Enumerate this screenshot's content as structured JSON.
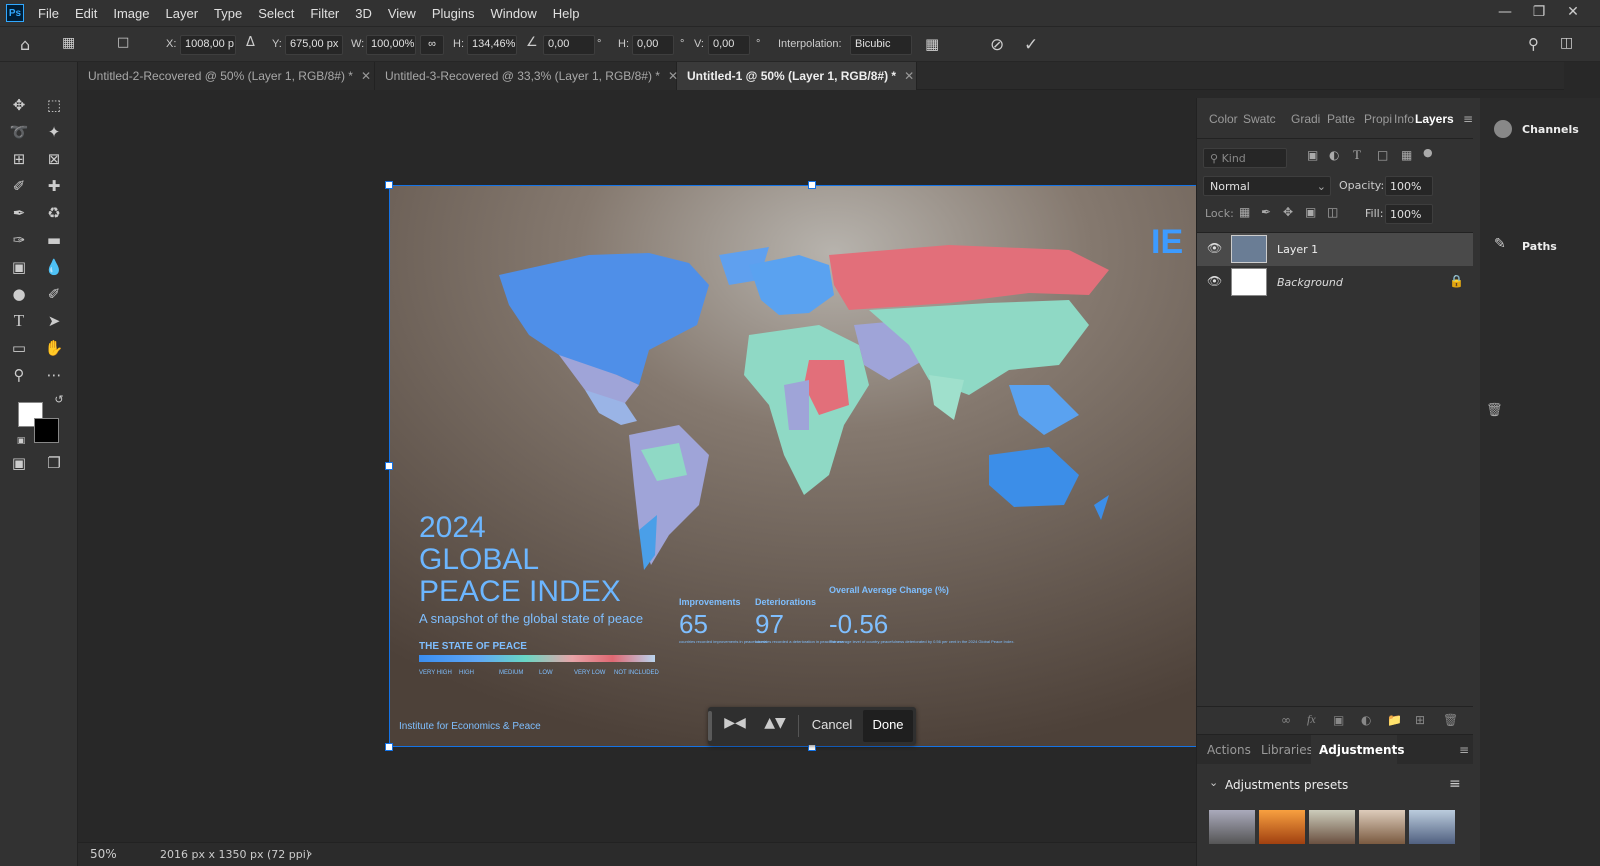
{
  "app": {
    "logo": "Ps",
    "menu": [
      "File",
      "Edit",
      "Image",
      "Layer",
      "Type",
      "Select",
      "Filter",
      "3D",
      "View",
      "Plugins",
      "Window",
      "Help"
    ]
  },
  "options": {
    "x_label": "X:",
    "x_value": "1008,00 p",
    "y_label": "Y:",
    "y_value": "675,00 px",
    "w_label": "W:",
    "w_value": "100,00%",
    "h_label": "H:",
    "h_value": "134,46%",
    "angle_value": "0,00",
    "angle_unit": "°",
    "hskew_label": "H:",
    "hskew_value": "0,00",
    "vskew_label": "V:",
    "vskew_value": "0,00",
    "interp_label": "Interpolation:",
    "interp_value": "Bicubic"
  },
  "tabs": [
    {
      "label": "Untitled-2-Recovered @ 50% (Layer 1, RGB/8#) *"
    },
    {
      "label": "Untitled-3-Recovered @ 33,3% (Layer 1, RGB/8#) *"
    },
    {
      "label": "Untitled-1 @ 50% (Layer 1, RGB/8#) *"
    }
  ],
  "photo": {
    "year": "2024",
    "title_line1": "GLOBAL",
    "title_line2": "PEACE INDEX",
    "subtitle": "A snapshot of the global state of peace",
    "state_heading": "THE STATE OF PEACE",
    "legend": [
      "VERY HIGH",
      "HIGH",
      "MEDIUM",
      "LOW",
      "VERY LOW",
      "NOT INCLUDED"
    ],
    "stats": [
      {
        "label": "Improvements",
        "value": "65",
        "note": "countries recorded improvements in peacefulness"
      },
      {
        "label": "Deteriorations",
        "value": "97",
        "note": "countries recorded a deterioration in peacefulness"
      },
      {
        "label": "Overall Average Change (%)",
        "value": "-0.56",
        "note": "The average level of country peacefulness deteriorated by 0.56 per cent in the 2024 Global Peace Index."
      }
    ],
    "footer": "Institute for Economics & Peace",
    "corner_mark": "IE"
  },
  "transform_popup": {
    "cancel": "Cancel",
    "done": "Done"
  },
  "panels": {
    "tabs": [
      "Color",
      "Swatc",
      "Gradi",
      "Patte",
      "Propi",
      "Info",
      "Layers"
    ],
    "kind_placeholder": "Kind",
    "blend_mode": "Normal",
    "opacity_label": "Opacity:",
    "opacity_value": "100%",
    "lock_label": "Lock:",
    "fill_label": "Fill:",
    "fill_value": "100%",
    "layers": [
      {
        "name": "Layer 1"
      },
      {
        "name": "Background"
      }
    ],
    "bottom_tabs": [
      "Actions",
      "Libraries",
      "Adjustments"
    ],
    "adj_presets": "Adjustments presets",
    "channels": "Channels",
    "paths": "Paths"
  },
  "status": {
    "zoom": "50%",
    "doc_info": "2016 px x 1350 px (72 ppi)"
  },
  "colors": {
    "accent": "#1473e6",
    "bg": "#282828",
    "panel": "#323232"
  }
}
